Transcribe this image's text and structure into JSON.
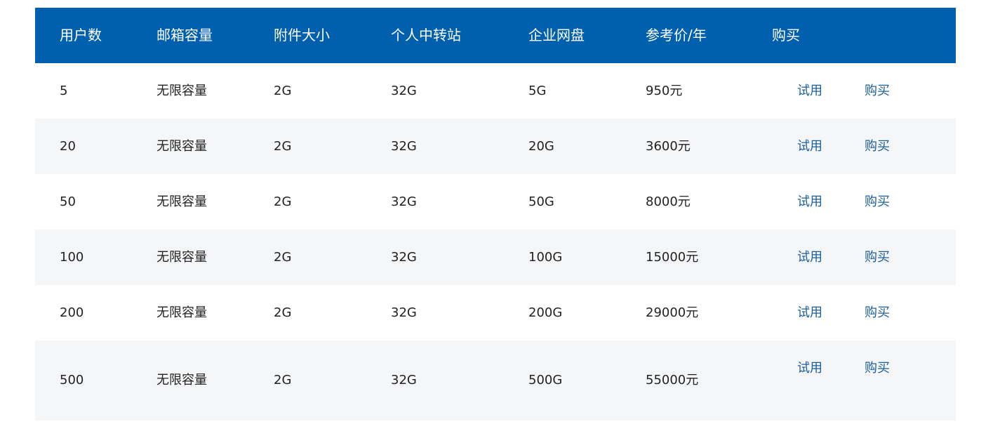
{
  "table": {
    "headers": [
      "用户数",
      "邮箱容量",
      "附件大小",
      "个人中转站",
      "企业网盘",
      "参考价/年",
      "购买"
    ],
    "trial_label": "试用",
    "buy_label": "购买",
    "rows": [
      [
        "5",
        "无限容量",
        "2G",
        "32G",
        "5G",
        "950元"
      ],
      [
        "20",
        "无限容量",
        "2G",
        "32G",
        "20G",
        "3600元"
      ],
      [
        "50",
        "无限容量",
        "2G",
        "32G",
        "50G",
        "8000元"
      ],
      [
        "100",
        "无限容量",
        "2G",
        "32G",
        "100G",
        "15000元"
      ],
      [
        "200",
        "无限容量",
        "2G",
        "32G",
        "200G",
        "29000元"
      ],
      [
        "500",
        "无限容量",
        "2G",
        "32G",
        "500G",
        "55000元"
      ]
    ]
  },
  "colors": {
    "header_bg": "#0060ae",
    "header_text": "#ffffff",
    "alt_row_bg": "#f5f6f8",
    "link": "#1a5e9a",
    "body_text": "#222222"
  }
}
